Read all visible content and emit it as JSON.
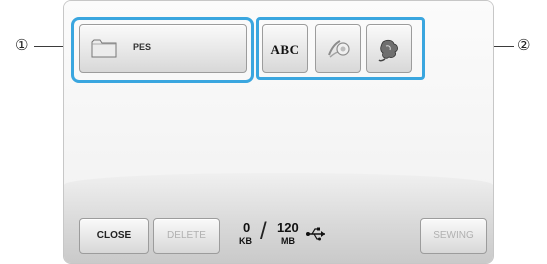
{
  "callouts": {
    "left": "①",
    "right": "②"
  },
  "folder": {
    "label": "PES",
    "icon": "folder-icon"
  },
  "categories": [
    {
      "label": "ABC",
      "icon": "abc-icon"
    },
    {
      "label": "",
      "icon": "frame-pattern-icon"
    },
    {
      "label": "",
      "icon": "embroidery-pattern-icon"
    }
  ],
  "footer": {
    "close_label": "CLOSE",
    "delete_label": "DELETE",
    "used_value": "0",
    "used_unit": "KB",
    "total_value": "120",
    "total_unit": "MB",
    "usb_icon": "usb-icon",
    "sewing_label": "SEWING"
  },
  "colors": {
    "highlight": "#3aa6df",
    "disabled_text": "#b0b0b0"
  }
}
